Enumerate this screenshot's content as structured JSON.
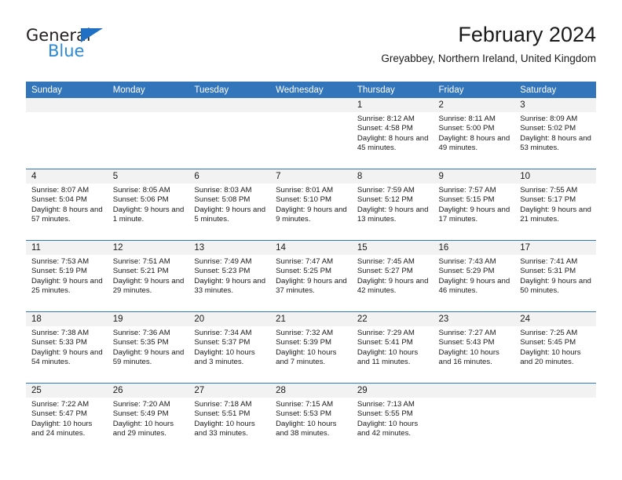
{
  "brand": {
    "name_top": "General",
    "name_bottom": "Blue",
    "triangle_icon": "triangle-icon",
    "accent_color": "#2b8ad6"
  },
  "header": {
    "title": "February 2024",
    "subtitle": "Greyabbey, Northern Ireland, United Kingdom"
  },
  "calendar": {
    "header_bg": "#3275bb",
    "date_band_bg": "#f2f2f2",
    "weekday_headers": [
      "Sunday",
      "Monday",
      "Tuesday",
      "Wednesday",
      "Thursday",
      "Friday",
      "Saturday"
    ],
    "weeks": [
      [
        {
          "date": "",
          "sunrise": "",
          "sunset": "",
          "daylight": ""
        },
        {
          "date": "",
          "sunrise": "",
          "sunset": "",
          "daylight": ""
        },
        {
          "date": "",
          "sunrise": "",
          "sunset": "",
          "daylight": ""
        },
        {
          "date": "",
          "sunrise": "",
          "sunset": "",
          "daylight": ""
        },
        {
          "date": "1",
          "sunrise": "Sunrise: 8:12 AM",
          "sunset": "Sunset: 4:58 PM",
          "daylight": "Daylight: 8 hours and 45 minutes."
        },
        {
          "date": "2",
          "sunrise": "Sunrise: 8:11 AM",
          "sunset": "Sunset: 5:00 PM",
          "daylight": "Daylight: 8 hours and 49 minutes."
        },
        {
          "date": "3",
          "sunrise": "Sunrise: 8:09 AM",
          "sunset": "Sunset: 5:02 PM",
          "daylight": "Daylight: 8 hours and 53 minutes."
        }
      ],
      [
        {
          "date": "4",
          "sunrise": "Sunrise: 8:07 AM",
          "sunset": "Sunset: 5:04 PM",
          "daylight": "Daylight: 8 hours and 57 minutes."
        },
        {
          "date": "5",
          "sunrise": "Sunrise: 8:05 AM",
          "sunset": "Sunset: 5:06 PM",
          "daylight": "Daylight: 9 hours and 1 minute."
        },
        {
          "date": "6",
          "sunrise": "Sunrise: 8:03 AM",
          "sunset": "Sunset: 5:08 PM",
          "daylight": "Daylight: 9 hours and 5 minutes."
        },
        {
          "date": "7",
          "sunrise": "Sunrise: 8:01 AM",
          "sunset": "Sunset: 5:10 PM",
          "daylight": "Daylight: 9 hours and 9 minutes."
        },
        {
          "date": "8",
          "sunrise": "Sunrise: 7:59 AM",
          "sunset": "Sunset: 5:12 PM",
          "daylight": "Daylight: 9 hours and 13 minutes."
        },
        {
          "date": "9",
          "sunrise": "Sunrise: 7:57 AM",
          "sunset": "Sunset: 5:15 PM",
          "daylight": "Daylight: 9 hours and 17 minutes."
        },
        {
          "date": "10",
          "sunrise": "Sunrise: 7:55 AM",
          "sunset": "Sunset: 5:17 PM",
          "daylight": "Daylight: 9 hours and 21 minutes."
        }
      ],
      [
        {
          "date": "11",
          "sunrise": "Sunrise: 7:53 AM",
          "sunset": "Sunset: 5:19 PM",
          "daylight": "Daylight: 9 hours and 25 minutes."
        },
        {
          "date": "12",
          "sunrise": "Sunrise: 7:51 AM",
          "sunset": "Sunset: 5:21 PM",
          "daylight": "Daylight: 9 hours and 29 minutes."
        },
        {
          "date": "13",
          "sunrise": "Sunrise: 7:49 AM",
          "sunset": "Sunset: 5:23 PM",
          "daylight": "Daylight: 9 hours and 33 minutes."
        },
        {
          "date": "14",
          "sunrise": "Sunrise: 7:47 AM",
          "sunset": "Sunset: 5:25 PM",
          "daylight": "Daylight: 9 hours and 37 minutes."
        },
        {
          "date": "15",
          "sunrise": "Sunrise: 7:45 AM",
          "sunset": "Sunset: 5:27 PM",
          "daylight": "Daylight: 9 hours and 42 minutes."
        },
        {
          "date": "16",
          "sunrise": "Sunrise: 7:43 AM",
          "sunset": "Sunset: 5:29 PM",
          "daylight": "Daylight: 9 hours and 46 minutes."
        },
        {
          "date": "17",
          "sunrise": "Sunrise: 7:41 AM",
          "sunset": "Sunset: 5:31 PM",
          "daylight": "Daylight: 9 hours and 50 minutes."
        }
      ],
      [
        {
          "date": "18",
          "sunrise": "Sunrise: 7:38 AM",
          "sunset": "Sunset: 5:33 PM",
          "daylight": "Daylight: 9 hours and 54 minutes."
        },
        {
          "date": "19",
          "sunrise": "Sunrise: 7:36 AM",
          "sunset": "Sunset: 5:35 PM",
          "daylight": "Daylight: 9 hours and 59 minutes."
        },
        {
          "date": "20",
          "sunrise": "Sunrise: 7:34 AM",
          "sunset": "Sunset: 5:37 PM",
          "daylight": "Daylight: 10 hours and 3 minutes."
        },
        {
          "date": "21",
          "sunrise": "Sunrise: 7:32 AM",
          "sunset": "Sunset: 5:39 PM",
          "daylight": "Daylight: 10 hours and 7 minutes."
        },
        {
          "date": "22",
          "sunrise": "Sunrise: 7:29 AM",
          "sunset": "Sunset: 5:41 PM",
          "daylight": "Daylight: 10 hours and 11 minutes."
        },
        {
          "date": "23",
          "sunrise": "Sunrise: 7:27 AM",
          "sunset": "Sunset: 5:43 PM",
          "daylight": "Daylight: 10 hours and 16 minutes."
        },
        {
          "date": "24",
          "sunrise": "Sunrise: 7:25 AM",
          "sunset": "Sunset: 5:45 PM",
          "daylight": "Daylight: 10 hours and 20 minutes."
        }
      ],
      [
        {
          "date": "25",
          "sunrise": "Sunrise: 7:22 AM",
          "sunset": "Sunset: 5:47 PM",
          "daylight": "Daylight: 10 hours and 24 minutes."
        },
        {
          "date": "26",
          "sunrise": "Sunrise: 7:20 AM",
          "sunset": "Sunset: 5:49 PM",
          "daylight": "Daylight: 10 hours and 29 minutes."
        },
        {
          "date": "27",
          "sunrise": "Sunrise: 7:18 AM",
          "sunset": "Sunset: 5:51 PM",
          "daylight": "Daylight: 10 hours and 33 minutes."
        },
        {
          "date": "28",
          "sunrise": "Sunrise: 7:15 AM",
          "sunset": "Sunset: 5:53 PM",
          "daylight": "Daylight: 10 hours and 38 minutes."
        },
        {
          "date": "29",
          "sunrise": "Sunrise: 7:13 AM",
          "sunset": "Sunset: 5:55 PM",
          "daylight": "Daylight: 10 hours and 42 minutes."
        },
        {
          "date": "",
          "sunrise": "",
          "sunset": "",
          "daylight": ""
        },
        {
          "date": "",
          "sunrise": "",
          "sunset": "",
          "daylight": ""
        }
      ]
    ]
  }
}
